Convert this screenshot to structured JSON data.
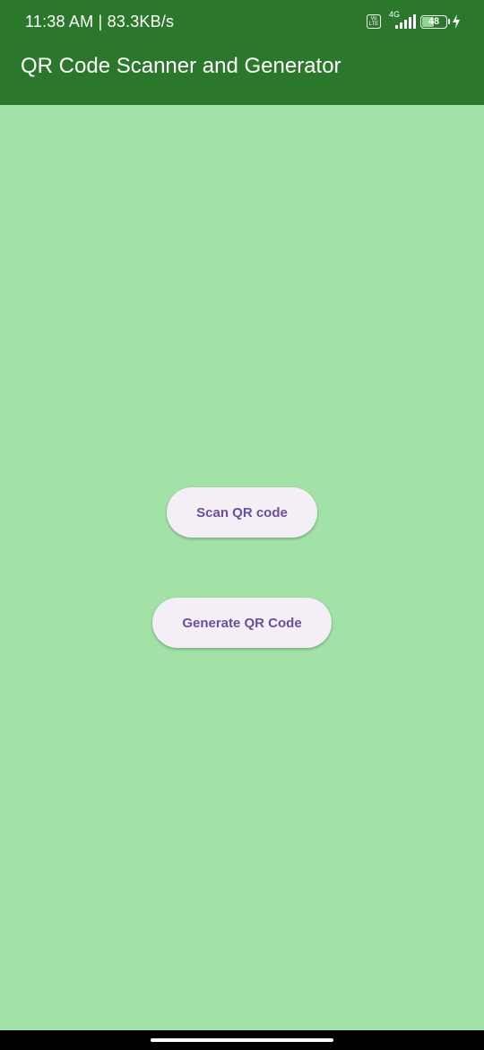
{
  "status_bar": {
    "time_speed": "11:38 AM | 83.3KB/s",
    "volte_label": "Vo LTE",
    "network_type": "4G",
    "battery_level": "48",
    "icons": [
      "volte-icon",
      "signal-icon",
      "battery-icon",
      "charging-icon"
    ]
  },
  "app_bar": {
    "title": "QR Code Scanner and Generator"
  },
  "main": {
    "scan_button_label": "Scan QR code",
    "generate_button_label": "Generate QR Code"
  },
  "colors": {
    "app_bar": "#2b782c",
    "background": "#a2e2a6",
    "button_bg": "#f4eff6",
    "button_text": "#6a4f9a"
  }
}
